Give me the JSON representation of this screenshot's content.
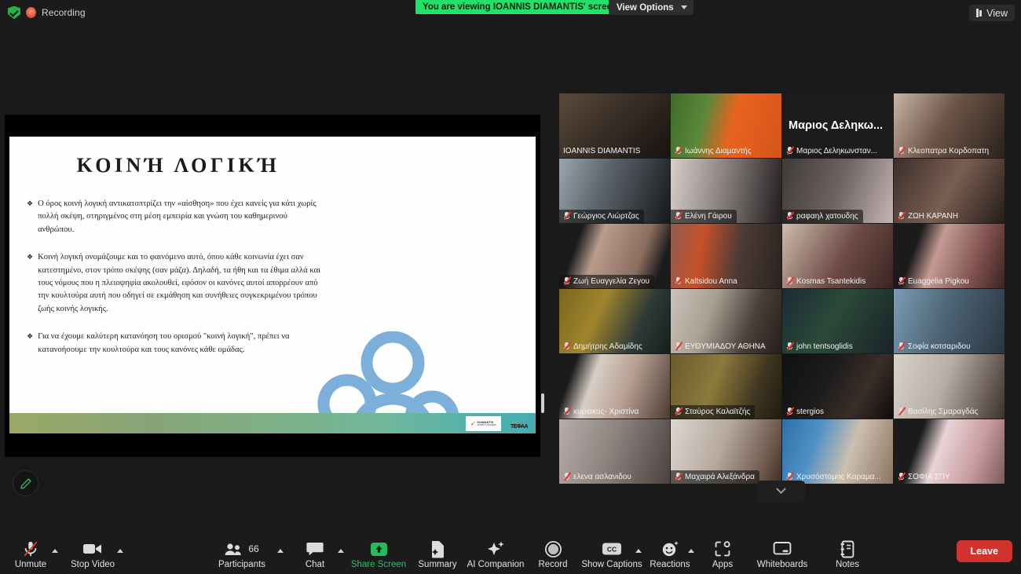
{
  "topbar": {
    "recording_label": "Recording",
    "shield_icon": "security-shield-icon",
    "record_dot_icon": "recording-dot-icon",
    "viewing_banner": "You are viewing IOANNIS DIAMANTIS' screen",
    "view_options_label": "View Options",
    "view_button_label": "View"
  },
  "slide": {
    "title": "ΚΟΙΝΉ ΛΟΓΙΚΉ",
    "bullet_mark": "❖",
    "bullets": [
      "Ο όρος κοινή λογική αντικατοπτρίζει την «αίσθηση» που έχει κανείς για κάτι χωρίς πολλή σκέψη, στηριγμένος στη μέση εμπειρία και γνώση του καθημερινού ανθρώπου.",
      "Κοινή λογική ονομάζουμε και το φαινόμενο αυτό, όπου κάθε κοινωνία έχει σαν κατεστημένο, στον τρόπο σκέψης (σαν μάζα). Δηλαδή, τα ήθη και τα έθιμα αλλά και τους νόμους που η πλειοψηφία ακολουθεί, εφόσον οι κανόνες αυτοί απορρέουν από την κουλτούρα αυτή που οδηγεί σε εκμάθηση και συνήθειες συγκεκριμένου τρόπου ζωής κοινής λογικής.",
      "Για να έχουμε καλύτερη κατανόηση του ορισμού \"κοινή λογική\", πρέπει να κατανοήσουμε την κουλτούρα και τους κανόνες κάθε ομάδας."
    ],
    "graphic": "three-people-group-icon",
    "footer_logo_text": "DIAMANTIS",
    "footer_logo_sub": "SPORTS ACADEMY",
    "footer_logo2_text": "ΤΕΦΑΑ",
    "band_colors": [
      "#9aa866",
      "#45aeb2"
    ]
  },
  "annotate": {
    "icon": "pencil-annotate-icon"
  },
  "participants": [
    {
      "name": "IOANNIS DIAMANTIS",
      "active": true,
      "muted": false,
      "name_style": "plain",
      "video": "person-cap-dark-room"
    },
    {
      "name": "Ιωάννης Διαμαντής",
      "active": false,
      "muted": true,
      "name_style": "plain",
      "video": "orange-runner-banner"
    },
    {
      "name": "Μαριος Δεληκωνσταν...",
      "active": false,
      "muted": true,
      "name_style": "plain",
      "video": "name-only-dark",
      "display_name": "Μαριος Δεληκω..."
    },
    {
      "name": "Κλεοπατρα Κορδοπατη",
      "active": false,
      "muted": true,
      "name_style": "plain",
      "video": "girl-dark-hair-room"
    },
    {
      "name": "Γεώργιος Λιώρτζας",
      "active": false,
      "muted": true,
      "name_style": "box",
      "video": "dark-silhouette-wall"
    },
    {
      "name": "Ελένη Γάιρου",
      "active": false,
      "muted": true,
      "name_style": "box",
      "video": "curtain-silhouette"
    },
    {
      "name": "ραφαηλ χατουδης",
      "active": false,
      "muted": true,
      "name_style": "box",
      "video": "boy-curtain-room"
    },
    {
      "name": "ΖΩΗ ΚΑΡΑΝΗ",
      "active": false,
      "muted": true,
      "name_style": "plain",
      "video": "girl-headphones"
    },
    {
      "name": "Ζωή  Ευαγγελία Ζεγου",
      "active": false,
      "muted": true,
      "name_style": "box",
      "video": "two-girls-room"
    },
    {
      "name": "Kaltsidou Anna",
      "active": false,
      "muted": true,
      "name_style": "plain",
      "video": "girl-orange-curtain"
    },
    {
      "name": "Kosmas Tsantekidis",
      "active": false,
      "muted": true,
      "name_style": "plain",
      "video": "boy-maroon-hoodie"
    },
    {
      "name": "Euaggelia Pigkou",
      "active": false,
      "muted": true,
      "name_style": "plain",
      "video": "girl-pink-wall"
    },
    {
      "name": "Δημήτρης Αδαμίδης",
      "active": false,
      "muted": true,
      "name_style": "plain",
      "video": "dim-yellow-room"
    },
    {
      "name": "ΕΥΘΥΜΙΑΔΟΥ ΑΘΗΝΑ",
      "active": false,
      "muted": true,
      "name_style": "plain",
      "video": "girl-bedroom"
    },
    {
      "name": "john tentsoglidis",
      "active": false,
      "muted": true,
      "name_style": "plain",
      "video": "boy-green-headset"
    },
    {
      "name": "Σοφία κοτσαριδου",
      "active": false,
      "muted": true,
      "name_style": "plain",
      "video": "girl-blue-room"
    },
    {
      "name": "κυριακος- Χριστίνα",
      "active": false,
      "muted": true,
      "name_style": "plain",
      "video": "two-people-bright"
    },
    {
      "name": "Σταύρος Καλαϊτζής",
      "active": false,
      "muted": true,
      "name_style": "box",
      "video": "boy-headphones-frames"
    },
    {
      "name": "stergios",
      "active": false,
      "muted": true,
      "name_style": "plain",
      "video": "boy-dark-room"
    },
    {
      "name": "Βασίλης Σμαραγδάς",
      "active": false,
      "muted": true,
      "name_style": "plain",
      "video": "boy-white-wall"
    },
    {
      "name": "ελενα ασλανιδου",
      "active": false,
      "muted": true,
      "name_style": "plain",
      "video": "girl-grey-wall"
    },
    {
      "name": "Μαχαιρά Αλεξάνδρα",
      "active": false,
      "muted": true,
      "name_style": "box",
      "video": "girl-curly-hair"
    },
    {
      "name": "Χρυσόστομος Καραμα...",
      "active": false,
      "muted": true,
      "name_style": "plain",
      "video": "boy-blue-background"
    },
    {
      "name": "ΣΟΦΙΑ ΣΠΥ",
      "active": false,
      "muted": true,
      "name_style": "plain",
      "video": "girl-glasses-ringlight"
    }
  ],
  "grid_more": {
    "icon": "chevron-down-icon"
  },
  "toolbar": {
    "items": [
      {
        "label": "Unmute",
        "icon": "microphone-muted-icon",
        "caret": true,
        "highlight": false
      },
      {
        "label": "Stop Video",
        "icon": "video-camera-icon",
        "caret": true,
        "highlight": false
      },
      {
        "label": "Participants",
        "icon": "participants-icon",
        "caret": true,
        "highlight": false,
        "badge": "66"
      },
      {
        "label": "Chat",
        "icon": "chat-bubble-icon",
        "caret": true,
        "highlight": false
      },
      {
        "label": "Share Screen",
        "icon": "share-screen-icon",
        "caret": false,
        "highlight": true
      },
      {
        "label": "Summary",
        "icon": "summary-doc-icon",
        "caret": false,
        "highlight": false
      },
      {
        "label": "AI Companion",
        "icon": "ai-sparkle-icon",
        "caret": false,
        "highlight": false
      },
      {
        "label": "Record",
        "icon": "record-circle-icon",
        "caret": false,
        "highlight": false
      },
      {
        "label": "Show Captions",
        "icon": "closed-captions-icon",
        "caret": true,
        "highlight": false
      },
      {
        "label": "Reactions",
        "icon": "reactions-smiley-icon",
        "caret": true,
        "highlight": false
      },
      {
        "label": "Apps",
        "icon": "apps-icon",
        "caret": false,
        "highlight": false
      },
      {
        "label": "Whiteboards",
        "icon": "whiteboard-icon",
        "caret": false,
        "highlight": false
      },
      {
        "label": "Notes",
        "icon": "notes-icon",
        "caret": false,
        "highlight": false
      }
    ],
    "participants_count": "66",
    "leave_label": "Leave",
    "accent_green": "#27c463",
    "leave_red": "#d0342c"
  }
}
